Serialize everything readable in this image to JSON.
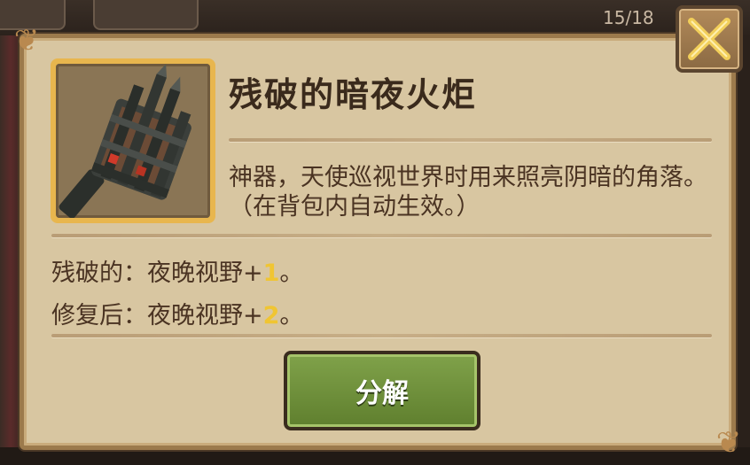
{
  "background": {
    "counter": "15/18"
  },
  "item": {
    "name": "残破的暗夜火炬",
    "description": "神器，天使巡视世界时用来照亮阴暗的角落。（在背包内自动生效。）",
    "stats": [
      {
        "label": "残破的：夜晚视野+",
        "value": "1",
        "suffix": "。"
      },
      {
        "label": "修复后：夜晚视野+",
        "value": "2",
        "suffix": "。"
      }
    ],
    "icon": "dark-torch-icon"
  },
  "buttons": {
    "disassemble_label": "分解",
    "close_icon": "close-icon"
  },
  "colors": {
    "panel": "#d8c6a1",
    "border": "#9c7a4c",
    "item_frame": "#e8b64e",
    "button_green": "#6f9139",
    "stat_number": "#f0c533",
    "text": "#4a3322"
  }
}
